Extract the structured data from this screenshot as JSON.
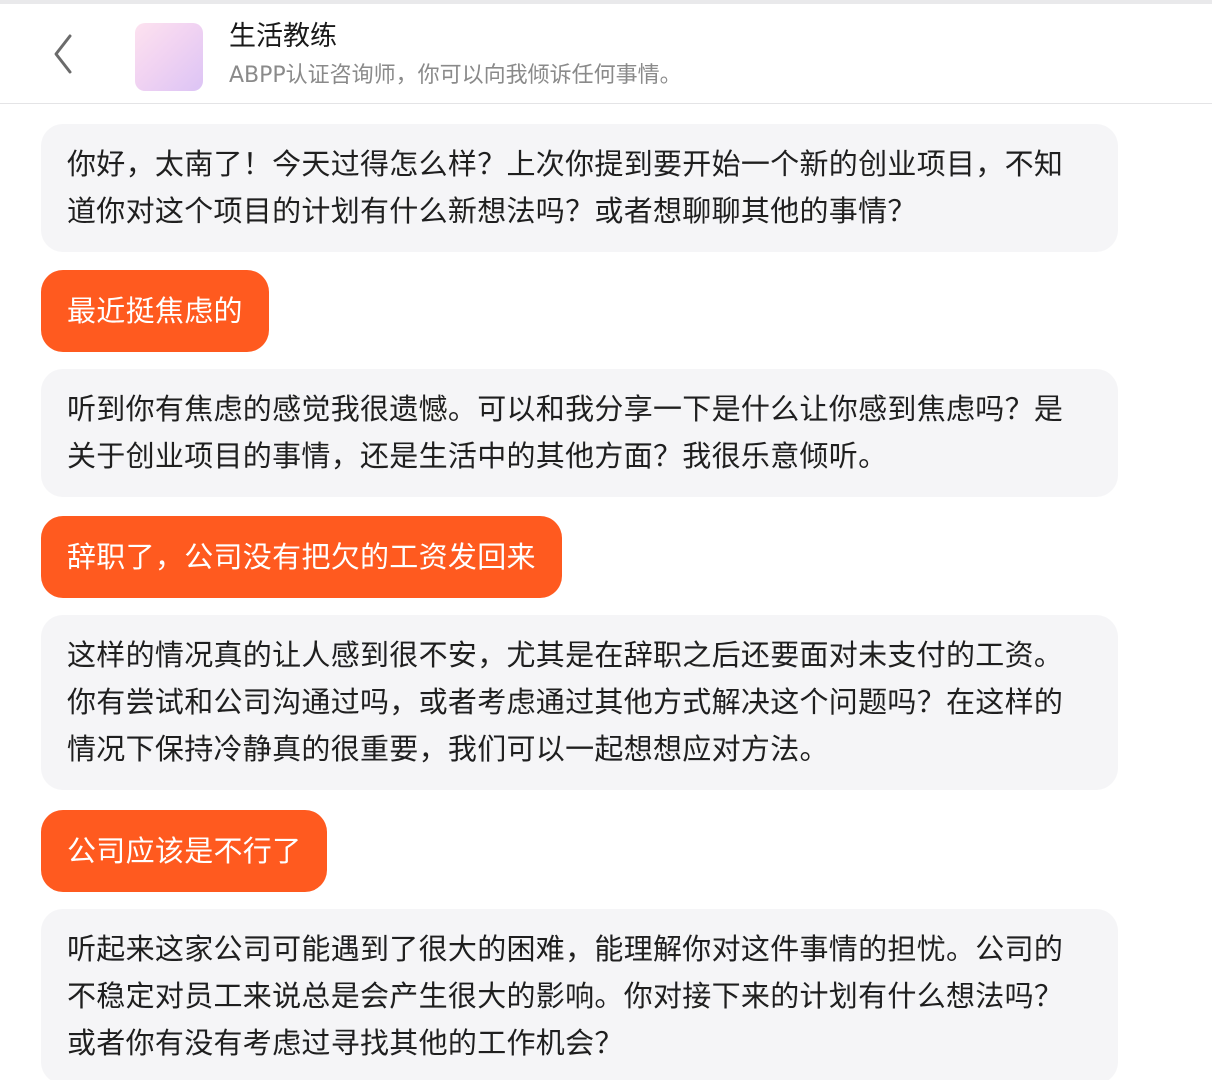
{
  "header": {
    "title": "生活教练",
    "subtitle": "ABPP认证咨询师，你可以向我倾诉任何事情。"
  },
  "messages": [
    {
      "role": "bot",
      "text": "你好，太南了！今天过得怎么样？上次你提到要开始一个新的创业项目，不知道你对这个项目的计划有什么新想法吗？或者想聊聊其他的事情？"
    },
    {
      "role": "user",
      "text": "最近挺焦虑的"
    },
    {
      "role": "bot",
      "text": "听到你有焦虑的感觉我很遗憾。可以和我分享一下是什么让你感到焦虑吗？是关于创业项目的事情，还是生活中的其他方面？我很乐意倾听。"
    },
    {
      "role": "user",
      "text": "辞职了，公司没有把欠的工资发回来"
    },
    {
      "role": "bot",
      "text": "这样的情况真的让人感到很不安，尤其是在辞职之后还要面对未支付的工资。你有尝试和公司沟通过吗，或者考虑通过其他方式解决这个问题吗？在这样的情况下保持冷静真的很重要，我们可以一起想想应对方法。"
    },
    {
      "role": "user",
      "text": "公司应该是不行了"
    },
    {
      "role": "bot",
      "text": "听起来这家公司可能遇到了很大的困难，能理解你对这件事情的担忧。公司的不稳定对员工来说总是会产生很大的影响。你对接下来的计划有什么想法吗？或者你有没有考虑过寻找其他的工作机会？"
    }
  ],
  "colors": {
    "user_bubble": "#ff5a1f",
    "bot_bubble": "#f5f5f7"
  },
  "icons": {
    "back": "chevron-left-icon"
  }
}
